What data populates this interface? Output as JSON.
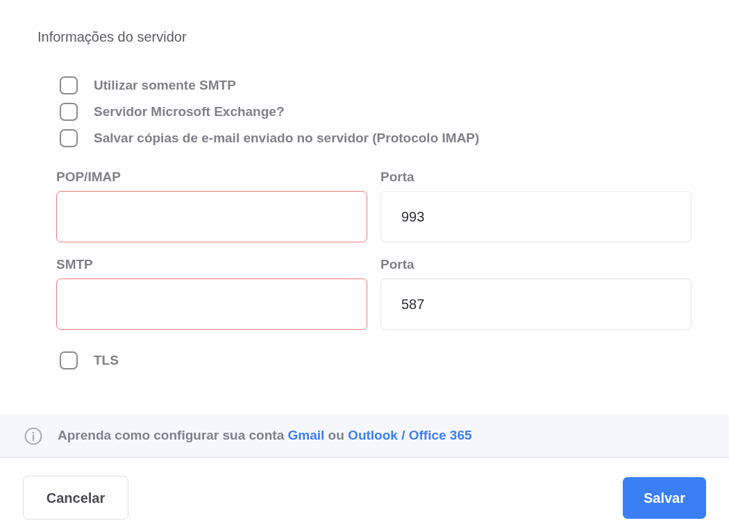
{
  "section_title": "Informações do servidor",
  "options": [
    {
      "label": "Utilizar somente SMTP",
      "checked": false
    },
    {
      "label": "Servidor Microsoft Exchange?",
      "checked": false
    },
    {
      "label": "Salvar cópias de e-mail enviado no servidor (Protocolo IMAP)",
      "checked": false
    }
  ],
  "server_rows": [
    {
      "host": {
        "label": "POP/IMAP",
        "invalid": true
      },
      "port": {
        "label": "Porta",
        "value": "993",
        "invalid": false
      }
    },
    {
      "host": {
        "label": "SMTP",
        "invalid": true
      },
      "port": {
        "label": "Porta",
        "value": "587",
        "invalid": false
      }
    }
  ],
  "tls": {
    "label": "TLS",
    "checked": false
  },
  "help": {
    "parts": [
      {
        "kind": "text",
        "text": "Aprenda como configurar sua conta"
      },
      {
        "kind": "link",
        "text": "Gmail"
      },
      {
        "kind": "text",
        "text": "ou"
      },
      {
        "kind": "link",
        "text": "Outlook / Office 365"
      }
    ]
  },
  "buttons": [
    {
      "kind": "secondary",
      "label": "Cancelar"
    },
    {
      "kind": "primary",
      "label": "Salvar"
    }
  ]
}
